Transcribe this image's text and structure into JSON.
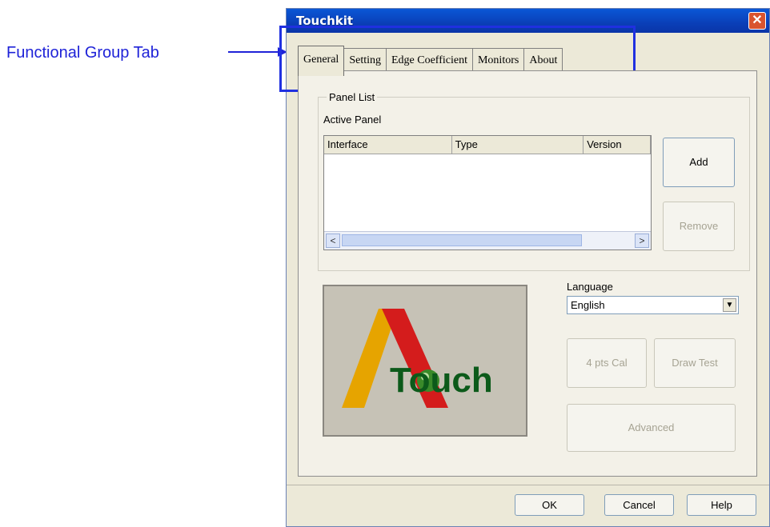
{
  "annotation": {
    "label": "Functional Group Tab"
  },
  "window": {
    "title": "Touchkit",
    "close_icon": "close-icon",
    "close_glyph": "✕"
  },
  "tabs": [
    {
      "label": "General",
      "active": true
    },
    {
      "label": "Setting"
    },
    {
      "label": "Edge Coefficient"
    },
    {
      "label": "Monitors"
    },
    {
      "label": "About"
    }
  ],
  "panel_list": {
    "title": "Panel List",
    "active_panel_label": "Active Panel",
    "columns": [
      "Interface",
      "Type",
      "Version"
    ],
    "rows": [],
    "scroll_left_glyph": "<",
    "scroll_right_glyph": ">"
  },
  "buttons": {
    "add": "Add",
    "remove": "Remove",
    "cal": "4 pts Cal",
    "draw_test": "Draw Test",
    "advanced": "Advanced",
    "ok": "OK",
    "cancel": "Cancel",
    "help": "Help"
  },
  "language": {
    "label": "Language",
    "selected": "English",
    "arrow_glyph": "▼"
  },
  "logo": {
    "text": "Touch",
    "letter": "A"
  },
  "colors": {
    "logo_yellow": "#e6a400",
    "logo_red": "#d41c1c",
    "logo_green": "#0c5a1a",
    "annotation_blue": "#2030e0"
  }
}
